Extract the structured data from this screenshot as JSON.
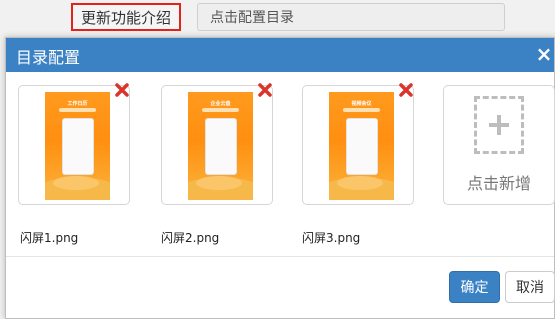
{
  "background": {
    "update_button_label": "更新功能介绍",
    "directory_input_value": "点击配置目录"
  },
  "modal": {
    "title": "目录配置",
    "close_icon": "close-icon",
    "images": [
      {
        "file_name": "闪屏1.png",
        "poster_title": "工作日历"
      },
      {
        "file_name": "闪屏2.png",
        "poster_title": "企业云盘"
      },
      {
        "file_name": "闪屏3.png",
        "poster_title": "视频会议"
      }
    ],
    "add_tile_label": "点击新增",
    "confirm_label": "确定",
    "cancel_label": "取消"
  },
  "colors": {
    "header_blue": "#3b82c5",
    "highlight_red": "#e2231a",
    "poster_orange": "#ff9a1e"
  }
}
